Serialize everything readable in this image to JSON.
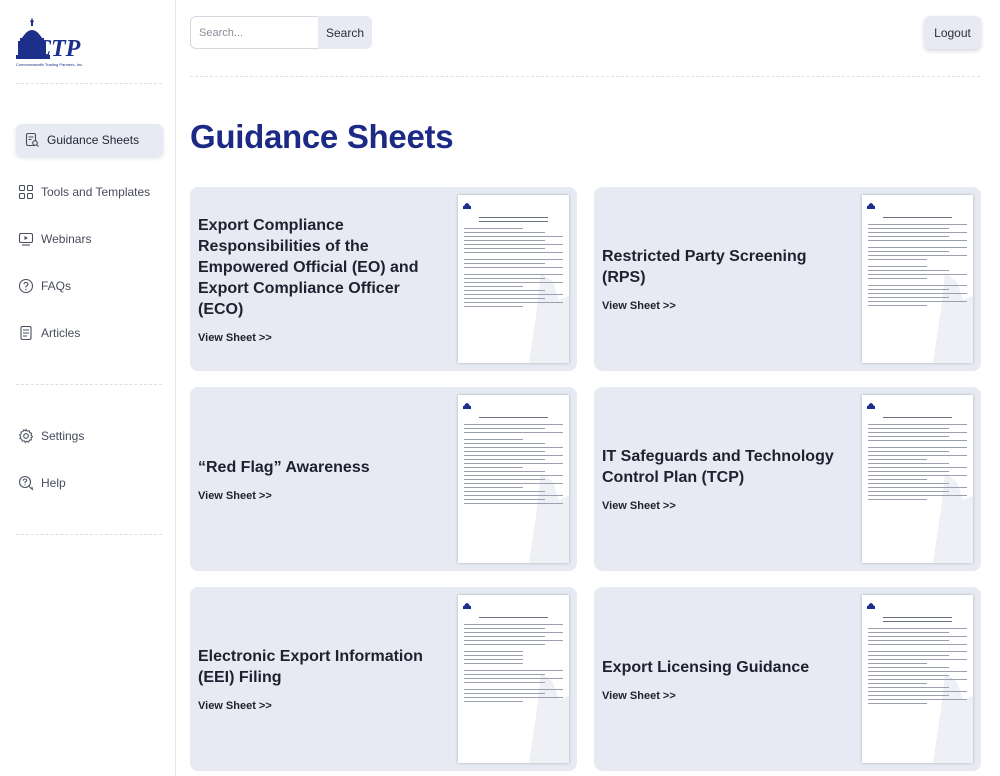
{
  "brand": {
    "logo_text": "CTP",
    "company": "Commonwealth Trading Partners, Inc."
  },
  "header": {
    "search_placeholder": "Search...",
    "search_label": "Search",
    "logout_label": "Logout"
  },
  "sidebar": {
    "items": [
      {
        "label": "Guidance Sheets",
        "icon": "document-search-icon",
        "active": true
      },
      {
        "label": "Tools and Templates",
        "icon": "grid-icon",
        "active": false
      },
      {
        "label": "Webinars",
        "icon": "video-icon",
        "active": false
      },
      {
        "label": "FAQs",
        "icon": "question-icon",
        "active": false
      },
      {
        "label": "Articles",
        "icon": "article-icon",
        "active": false
      }
    ],
    "secondary": [
      {
        "label": "Settings",
        "icon": "gear-icon"
      },
      {
        "label": "Help",
        "icon": "help-chat-icon"
      }
    ]
  },
  "main": {
    "title": "Guidance Sheets",
    "cards": [
      {
        "title": "Export Compliance Responsibilities of the Empowered Official (EO) and Export Compliance Officer (ECO)",
        "link": "View Sheet >>"
      },
      {
        "title": "Restricted Party Screening (RPS)",
        "link": "View Sheet >>"
      },
      {
        "title": "“Red Flag” Awareness",
        "link": "View Sheet >>"
      },
      {
        "title": "IT Safeguards and Technology Control Plan (TCP)",
        "link": "View Sheet >>"
      },
      {
        "title": "Electronic Export Information (EEI) Filing",
        "link": "View Sheet >>"
      },
      {
        "title": "Export Licensing Guidance",
        "link": "View Sheet >>"
      }
    ]
  },
  "colors": {
    "accent": "#1c2a86",
    "card_bg": "#e7eaf3",
    "active_nav_bg": "#e7eaf3"
  }
}
